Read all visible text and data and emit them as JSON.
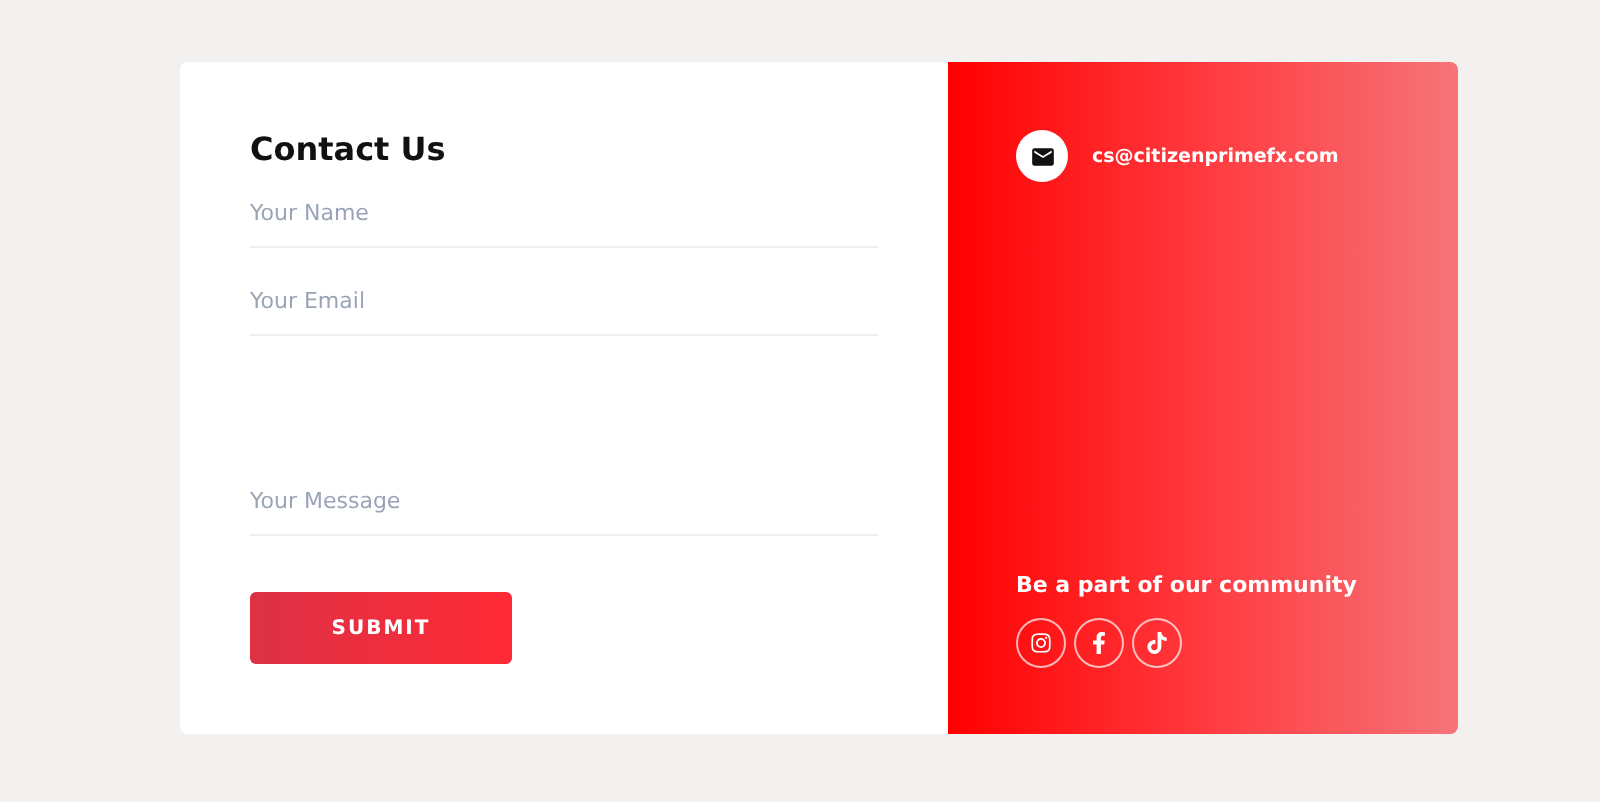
{
  "form": {
    "title": "Contact Us",
    "fields": [
      {
        "kind": "text",
        "placeholder": "Your Name"
      },
      {
        "kind": "text",
        "placeholder": "Your Email"
      },
      {
        "kind": "message",
        "placeholder": "Your Message"
      }
    ],
    "submit": "SUBMIT"
  },
  "info": {
    "email": "cs@citizenprimefx.com",
    "community": "Be a part of our community"
  }
}
